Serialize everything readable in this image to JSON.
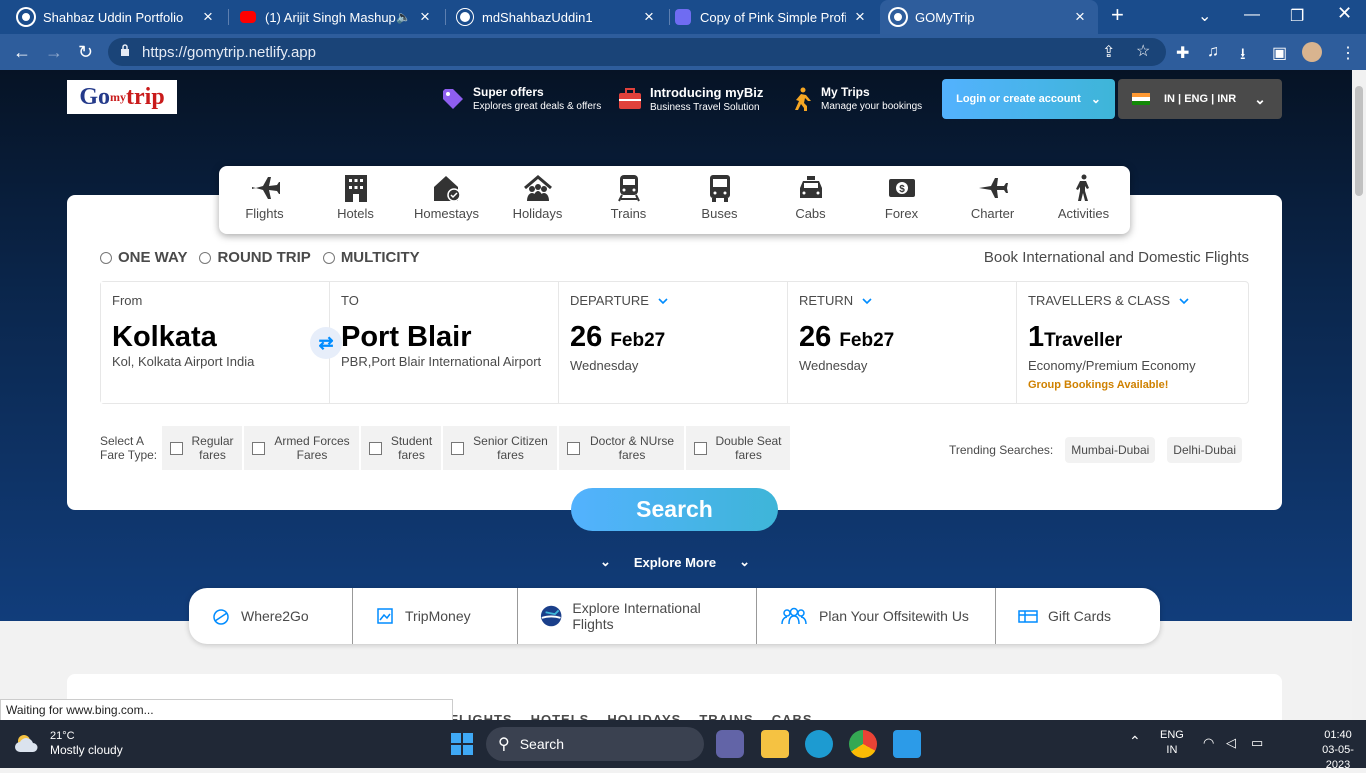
{
  "browser": {
    "tabs": [
      {
        "title": "Shahbaz Uddin Portfolio",
        "icon": "chrome-globe-icon"
      },
      {
        "title": "(1) Arijit Singh Mashup |",
        "icon": "youtube-icon",
        "audio": "🔈"
      },
      {
        "title": "mdShahbazUddin1",
        "icon": "github-icon"
      },
      {
        "title": "Copy of Pink Simple Profile R",
        "icon": "canva-icon"
      },
      {
        "title": "GOMyTrip",
        "icon": "chrome-globe-icon",
        "active": true
      }
    ],
    "url": "https://gomytrip.netlify.app"
  },
  "header": {
    "logo": {
      "part1": "Go",
      "part2": "my",
      "part3": "trip"
    },
    "items": [
      {
        "title": "Super offers",
        "subtitle": "Explores great deals & offers",
        "icon": "tag-icon"
      },
      {
        "title": "Introducing myBiz",
        "subtitle": "Business Travel Solution",
        "icon": "briefcase-icon"
      },
      {
        "title": "My Trips",
        "subtitle": "Manage your bookings",
        "icon": "traveller-icon"
      }
    ],
    "login": "Login or create account",
    "lang": "IN | ENG | INR"
  },
  "nav": [
    {
      "label": "Flights",
      "icon": "plane-icon"
    },
    {
      "label": "Hotels",
      "icon": "hotel-icon"
    },
    {
      "label": "Homestays",
      "icon": "homestay-icon"
    },
    {
      "label": "Holidays",
      "icon": "holiday-icon"
    },
    {
      "label": "Trains",
      "icon": "train-icon"
    },
    {
      "label": "Buses",
      "icon": "bus-icon"
    },
    {
      "label": "Cabs",
      "icon": "cab-icon"
    },
    {
      "label": "Forex",
      "icon": "forex-icon"
    },
    {
      "label": "Charter",
      "icon": "charter-icon"
    },
    {
      "label": "Activities",
      "icon": "activities-icon"
    }
  ],
  "trip_types": [
    "ONE WAY",
    "ROUND TRIP",
    "MULTICITY"
  ],
  "book_tagline": "Book International and Domestic Flights",
  "fields": {
    "from": {
      "label": "From",
      "value": "Kolkata",
      "sub": "Kol, Kolkata Airport India"
    },
    "to": {
      "label": "TO",
      "value": "Port Blair",
      "sub": "PBR,Port Blair International Airport"
    },
    "departure": {
      "label": "DEPARTURE",
      "day": "26",
      "month": "Feb27",
      "weekday": "Wednesday"
    },
    "return": {
      "label": "RETURN",
      "day": "26",
      "month": "Feb27",
      "weekday": "Wednesday"
    },
    "travellers": {
      "label": "TRAVELLERS & CLASS",
      "count": "1",
      "unit": "Traveller",
      "class": "Economy/Premium Economy",
      "group": "Group Bookings Available!"
    }
  },
  "fare": {
    "label": "Select A Fare Type:",
    "options": [
      "Regular fares",
      "Armed Forces Fares",
      "Student fares",
      "Senior Citizen fares",
      "Doctor & NUrse fares",
      "Double Seat fares"
    ]
  },
  "trending": {
    "label": "Trending Searches:",
    "items": [
      "Mumbai-Dubai",
      "Delhi-Dubai"
    ]
  },
  "search_label": "Search",
  "explore_label": "Explore More",
  "bottom_nav": [
    {
      "label": "Where2Go",
      "icon": "where2go-icon"
    },
    {
      "label": "TripMoney",
      "icon": "tripmoney-icon"
    },
    {
      "label": "Explore International Flights",
      "icon": "globe-icon"
    },
    {
      "label": "Plan Your Offsitewith Us",
      "icon": "group-icon"
    },
    {
      "label": "Gift Cards",
      "icon": "giftcard-icon"
    }
  ],
  "lower_tabs": [
    "FLIGHTS",
    "HOTELS",
    "HOLIDAYS",
    "TRAINS",
    "CABS"
  ],
  "status_text": "Waiting for www.bing.com...",
  "taskbar": {
    "weather_temp": "21°C",
    "weather_desc": "Mostly cloudy",
    "search": "Search",
    "lang1": "ENG",
    "lang2": "IN",
    "time": "01:40",
    "date": "03-05-2023"
  },
  "colors": {
    "accent": "#008cff",
    "button_gradient": "#53b2fe",
    "group_booking": "#cf8100",
    "hero_top": "#061325",
    "hero_bottom": "#113d7b"
  }
}
